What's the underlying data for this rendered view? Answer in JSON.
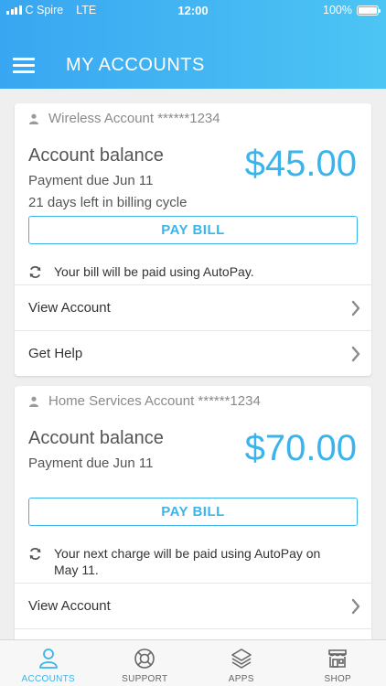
{
  "status_bar": {
    "carrier": "C Spire",
    "network": "LTE",
    "time": "12:00",
    "battery": "100%",
    "battery_level": 1.0
  },
  "header": {
    "title": "MY ACCOUNTS"
  },
  "accounts": [
    {
      "name": "Wireless Account ******1234",
      "balance_label": "Account balance",
      "amount": "$45.00",
      "due": "Payment due Jun 11",
      "cycle": "21 days left in billing cycle",
      "pay_label": "PAY BILL",
      "autopay": "Your bill will be paid using AutoPay.",
      "view_account": "View Account",
      "get_help": "Get Help"
    },
    {
      "name": "Home Services Account ******1234",
      "balance_label": "Account balance",
      "amount": "$70.00",
      "due": "Payment due Jun 11",
      "pay_label": "PAY BILL",
      "autopay": "Your next charge will be paid using AutoPay on May 11.",
      "view_account": "View Account"
    }
  ],
  "tabs": [
    {
      "label": "ACCOUNTS",
      "icon": "person-icon",
      "active": true
    },
    {
      "label": "SUPPORT",
      "icon": "lifebuoy-icon",
      "active": false
    },
    {
      "label": "APPS",
      "icon": "layers-icon",
      "active": false
    },
    {
      "label": "SHOP",
      "icon": "store-icon",
      "active": false
    }
  ],
  "colors": {
    "accent": "#3bb4ec",
    "header_start": "#39a6f1",
    "header_end": "#4cc5f4"
  }
}
